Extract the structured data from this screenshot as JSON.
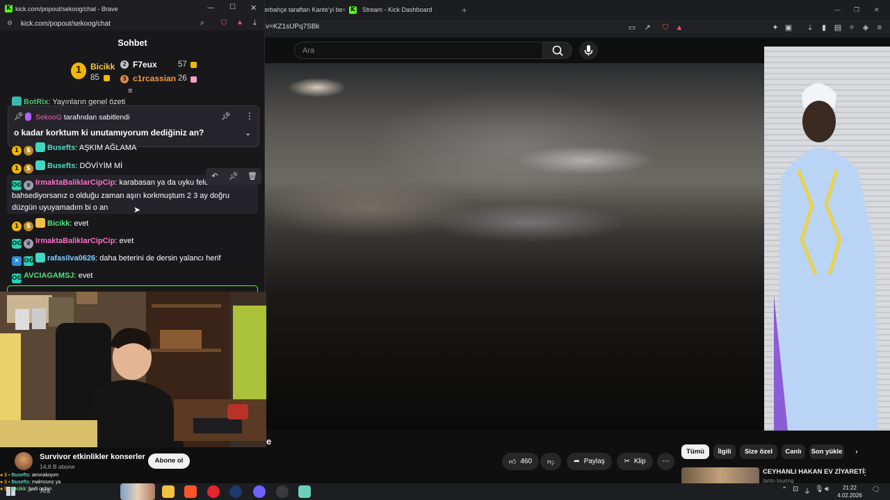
{
  "bg_browser": {
    "tabs": [
      {
        "label": "erbahçe taraftarı Kante'yi bel"
      },
      {
        "label": "Stream - Kick Dashboard"
      }
    ],
    "url": "v=KZ1sUPq7SBk"
  },
  "youtube": {
    "search_placeholder": "Ara",
    "video_title_fragment": "e",
    "channel": {
      "name": "Survivor  etkinlikler konserler",
      "subs": "14,8 B abone",
      "subscribe_label": "Abone ol"
    },
    "actions": {
      "like_count": "460",
      "share_label": "Paylaş",
      "clip_label": "Klip",
      "more": "⋯"
    },
    "chips": [
      "Tümü",
      "İlgili",
      "Size özel",
      "Canlı",
      "Son yükle"
    ],
    "recommended": {
      "title": "CEYHANLI HAKAN EV ZİYARETİ",
      "subtitle": "tanto touring"
    }
  },
  "popout": {
    "window_title": "kick.com/popout/sekoog/chat - Brave",
    "url": "kick.com/popout/sekoog/chat",
    "chat_title": "Sohbet",
    "leaderboard": {
      "first": {
        "rank": "1",
        "name": "Bicikk",
        "count": "85"
      },
      "second": {
        "rank": "2",
        "name": "F7eux",
        "count": "57"
      },
      "third": {
        "rank": "3",
        "name": "c1rcassian",
        "count": "26"
      }
    },
    "partial_top_line": {
      "user": "BotRix",
      "text": "Yayınların genel özeti"
    },
    "pinned": {
      "by_user": "SekooG",
      "by_text": "tarafından sabitlendi",
      "message": "o kadar korktum ki unutamıyorum dediğiniz an?"
    },
    "messages": [
      {
        "user": "Busefts",
        "text": "AŞKIM AĞLAMA",
        "color": "#53d8c5"
      },
      {
        "user": "Busefts",
        "text": "DÖVİYİM Mİ",
        "color": "#53d8c5"
      },
      {
        "user": "IrmaktaBaliklarCipCip",
        "text": "karabasan ya da uyku felcinden mi bahsediyorsanız o olduğu zaman aşırı korkmuştum 2 3 ay doğru düzgün uyuyamadım bi o an",
        "color": "#ff6ec7"
      },
      {
        "user": "Bicikk",
        "text": "evet",
        "color": "#53e07a"
      },
      {
        "user": "IrmaktaBaliklarCipCip",
        "text": "evet",
        "color": "#ff6ec7"
      },
      {
        "user": "rafasilva0626",
        "text": "daha beterini de dersin yalancı herif",
        "color": "#7fd0ff"
      },
      {
        "user": "AVCIAGAMSJ",
        "text": "evet",
        "color": "#53e07a"
      }
    ]
  },
  "mini_chat": [
    {
      "user": "Busefts",
      "text": ": amınakoyım"
    },
    {
      "user": "Busefts",
      "text": ": malmısınz ya"
    },
    {
      "user": "Bicikk",
      "text": ": hadi ordan"
    }
  ],
  "taskbar": {
    "search_placeholder": "Ara",
    "time": "21:22",
    "date": "4.02.2026"
  }
}
